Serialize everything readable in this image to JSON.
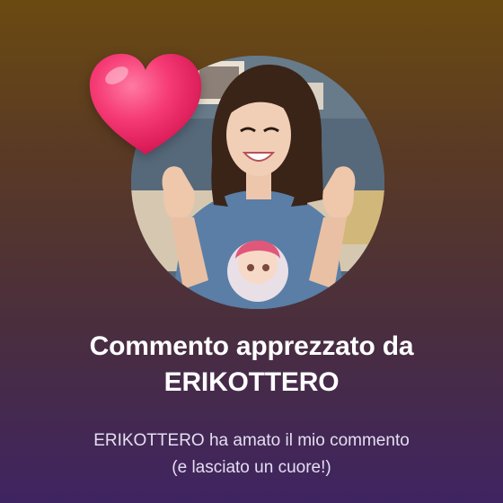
{
  "notification": {
    "title_line1": "Commento apprezzato da",
    "title_line2": "ERIKOTTERO",
    "body_line1": "ERIKOTTERO ha amato il mio commento",
    "body_line2": "(e lasciato un cuore!)"
  },
  "icons": {
    "heart": "heart-icon",
    "avatar": "avatar-photo"
  },
  "colors": {
    "heart": "#f0286a",
    "gradient_top": "#6b4a12",
    "gradient_bottom": "#3f2462",
    "title_text": "#ffffff",
    "body_text": "#e5def0"
  }
}
